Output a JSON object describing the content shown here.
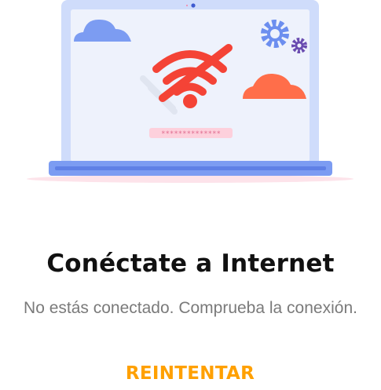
{
  "illustration": {
    "password_mask": "**************",
    "icons": [
      "laptop-icon",
      "cloud-icon",
      "wifi-off-icon",
      "gear-icon"
    ]
  },
  "content": {
    "title": "Conéctate a Internet",
    "subtitle": "No estás conectado. Comprueba la conexión."
  },
  "actions": {
    "retry_label": "REINTENTAR"
  },
  "colors": {
    "accent": "#FFA000",
    "wifi_error": "#F44336",
    "cloud_blue": "#7C9CF2",
    "cloud_orange": "#FF6E4A",
    "gear_blue": "#6C8EEF",
    "gear_purple": "#6A4CB0"
  }
}
